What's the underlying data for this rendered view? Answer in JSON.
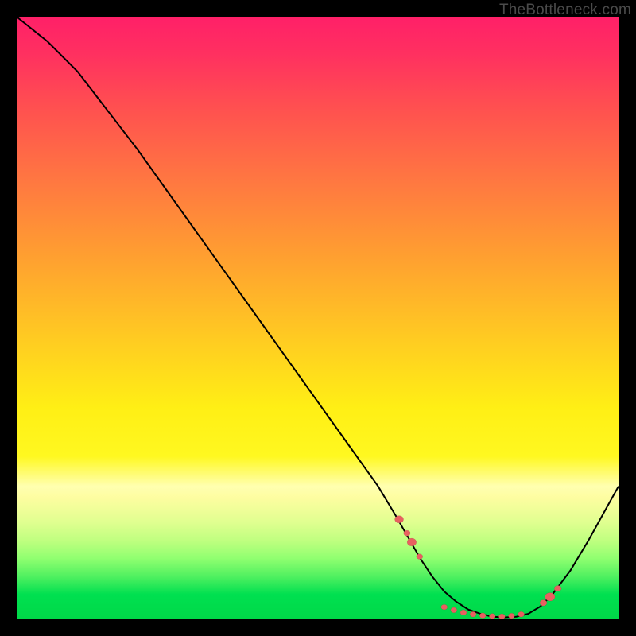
{
  "watermark": "TheBottleneck.com",
  "chart_data": {
    "type": "line",
    "title": "",
    "xlabel": "",
    "ylabel": "",
    "ylim": [
      0,
      100
    ],
    "x": [
      0,
      5,
      10,
      15,
      20,
      25,
      30,
      35,
      40,
      45,
      50,
      55,
      60,
      63,
      65,
      67,
      69,
      71,
      73,
      75,
      77,
      79,
      81,
      83,
      85,
      87,
      89,
      92,
      95,
      100
    ],
    "values": [
      100,
      96,
      91,
      84.5,
      78,
      71,
      64,
      57,
      50,
      43,
      36,
      29,
      22,
      17,
      13.5,
      10,
      7,
      4.5,
      2.8,
      1.5,
      0.8,
      0.3,
      0.2,
      0.3,
      0.8,
      2,
      4,
      8,
      13,
      22
    ],
    "markers": [
      {
        "x": 63.5,
        "y": 16.5,
        "r": 5.5
      },
      {
        "x": 64.8,
        "y": 14.2,
        "r": 4.2
      },
      {
        "x": 65.6,
        "y": 12.7,
        "r": 5.8
      },
      {
        "x": 66.9,
        "y": 10.3,
        "r": 4.0
      },
      {
        "x": 71.0,
        "y": 1.9,
        "r": 4.0
      },
      {
        "x": 72.6,
        "y": 1.4,
        "r": 4.0
      },
      {
        "x": 74.2,
        "y": 1.0,
        "r": 4.0
      },
      {
        "x": 75.8,
        "y": 0.7,
        "r": 4.0
      },
      {
        "x": 77.4,
        "y": 0.5,
        "r": 4.0
      },
      {
        "x": 79.0,
        "y": 0.4,
        "r": 4.0
      },
      {
        "x": 80.6,
        "y": 0.35,
        "r": 4.0
      },
      {
        "x": 82.2,
        "y": 0.45,
        "r": 4.0
      },
      {
        "x": 83.8,
        "y": 0.7,
        "r": 4.0
      },
      {
        "x": 87.5,
        "y": 2.6,
        "r": 4.5
      },
      {
        "x": 88.6,
        "y": 3.6,
        "r": 6.2
      },
      {
        "x": 89.9,
        "y": 5.0,
        "r": 4.5
      }
    ]
  }
}
